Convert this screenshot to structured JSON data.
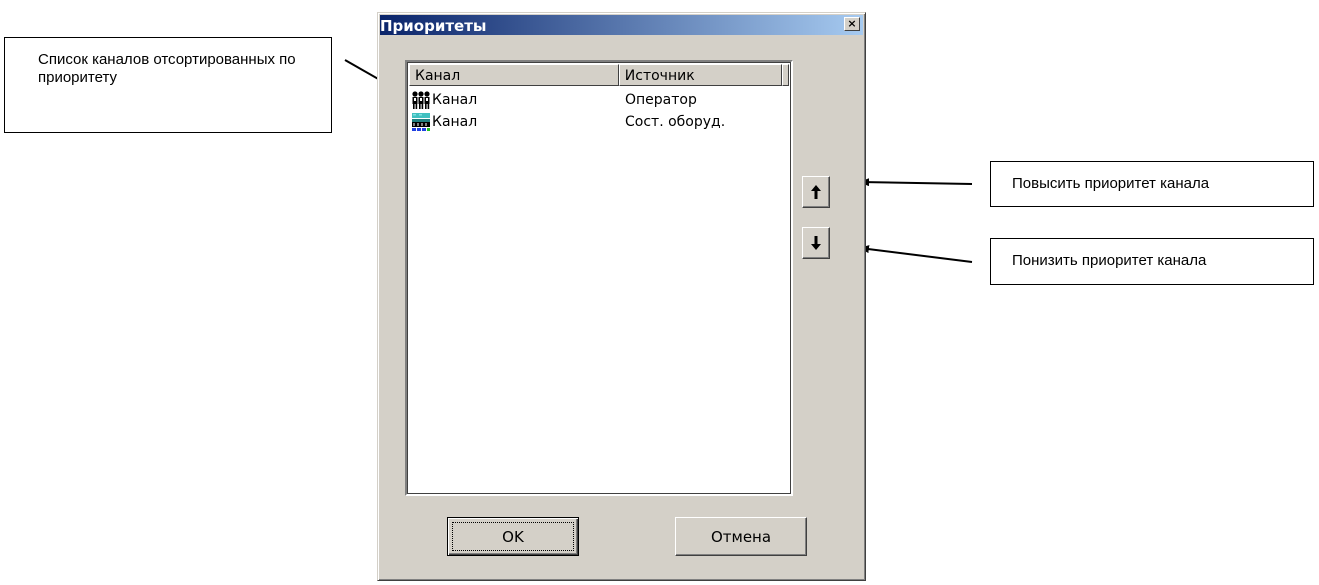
{
  "dialog": {
    "title": "Приоритеты",
    "close_glyph": "×",
    "columns": [
      "Канал",
      "Источник"
    ],
    "rows": [
      {
        "icon": "operators-group-icon",
        "name": "Канал",
        "source": "Оператор"
      },
      {
        "icon": "equipment-status-icon",
        "name": "Канал",
        "source": "Сост. оборуд."
      }
    ],
    "ok_label": "OK",
    "cancel_label": "Отмена",
    "up_icon": "arrow-up-icon",
    "down_icon": "arrow-down-icon"
  },
  "callouts": {
    "list": "Список каналов отсортированных по приоритету",
    "up": "Повысить приоритет канала",
    "down": "Понизить приоритет канала"
  },
  "colors": {
    "dialog_face": "#d4d0c8",
    "title_start": "#0a246a",
    "title_end": "#a6caf0",
    "list_bg": "#ffffff"
  }
}
